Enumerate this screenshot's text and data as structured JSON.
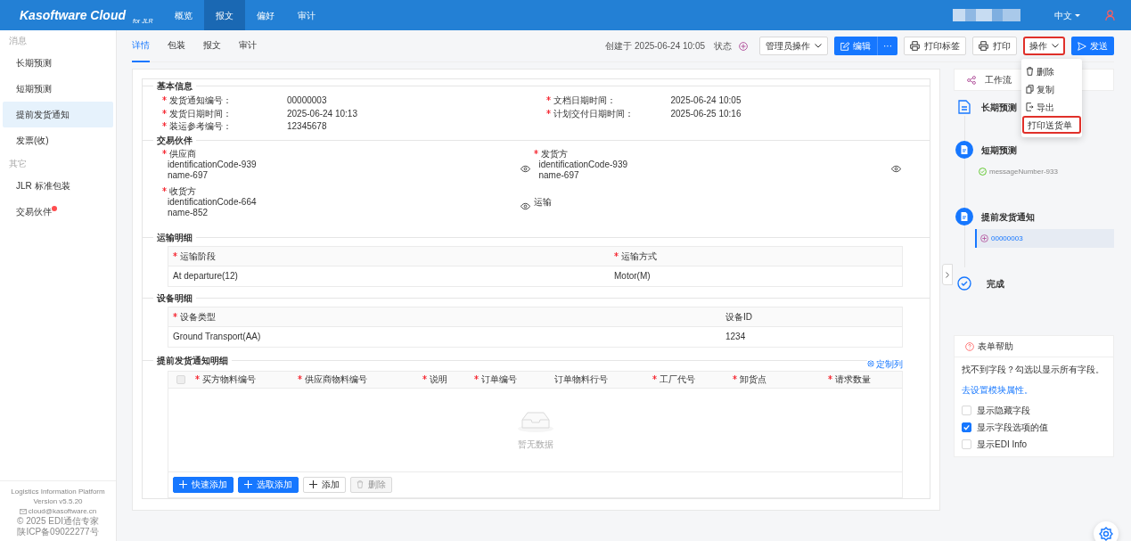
{
  "brand": {
    "name": "Kasoftware Cloud",
    "suffix": "for JLR"
  },
  "nav": [
    {
      "label": "概览",
      "selected": false
    },
    {
      "label": "报文",
      "selected": true
    },
    {
      "label": "偏好",
      "selected": false
    },
    {
      "label": "审计",
      "selected": false
    }
  ],
  "language": "中文",
  "sidebar": {
    "groups": [
      {
        "title": "消息",
        "items": [
          {
            "label": "长期预测",
            "selected": false
          },
          {
            "label": "短期预测",
            "selected": false
          },
          {
            "label": "提前发货通知",
            "selected": true
          },
          {
            "label": "发票(收)",
            "selected": false
          }
        ]
      },
      {
        "title": "其它",
        "items": [
          {
            "label": "JLR 标准包装",
            "selected": false
          },
          {
            "label": "交易伙伴",
            "selected": false,
            "badge": true
          }
        ]
      }
    ],
    "footer": [
      "Logistics Information Platform",
      "Version v5.5.20",
      "cloud@kasoftware.cn",
      "© 2025 EDI通信专家",
      "陕ICP备09022277号"
    ]
  },
  "tabs": [
    {
      "label": "详情",
      "selected": true
    },
    {
      "label": "包装",
      "selected": false
    },
    {
      "label": "报文",
      "selected": false
    },
    {
      "label": "审计",
      "selected": false
    }
  ],
  "toolbar": {
    "created": "创建于 2025-06-24 10:05",
    "status_label": "状态",
    "admin": "管理员操作",
    "edit": "编辑",
    "more": "···",
    "print_label": "打印标签",
    "print": "打印",
    "actions": {
      "label": "操作",
      "highlighted": true
    },
    "send": "发送"
  },
  "actions_menu": [
    {
      "label": "删除",
      "kind": "delete",
      "highlighted": false
    },
    {
      "label": "复制",
      "kind": "copy",
      "highlighted": false
    },
    {
      "label": "导出",
      "kind": "export",
      "highlighted": false
    },
    {
      "label": "打印送货单",
      "kind": "plain",
      "highlighted": true
    }
  ],
  "basic_info": {
    "title": "基本信息",
    "fields": [
      {
        "label": "发货通知编号：",
        "value": "00000003",
        "required": true
      },
      {
        "label": "文档日期时间：",
        "value": "2025-06-24 10:05",
        "required": true
      },
      {
        "label": "发货日期时间：",
        "value": "2025-06-24 10:13",
        "required": true
      },
      {
        "label": "计划交付日期时间：",
        "value": "2025-06-25 10:16",
        "required": true
      },
      {
        "label": "装运参考编号：",
        "value": "12345678",
        "required": true
      }
    ]
  },
  "partners": {
    "title": "交易伙伴",
    "items": [
      {
        "label": "供应商",
        "required": true,
        "lines": [
          "identificationCode-939",
          "name-697"
        ]
      },
      {
        "label": "发货方",
        "required": true,
        "lines": [
          "identificationCode-939",
          "name-697"
        ]
      },
      {
        "label": "收货方",
        "required": true,
        "lines": [
          "identificationCode-664",
          "name-852"
        ]
      },
      {
        "label": "运输",
        "required": false
      }
    ]
  },
  "transport": {
    "title": "运输明细",
    "columns": [
      {
        "label": "运输阶段",
        "required": true
      },
      {
        "label": "运输方式",
        "required": true
      }
    ],
    "rows": [
      [
        "At departure(12)",
        "Motor(M)"
      ]
    ]
  },
  "equipment": {
    "title": "设备明细",
    "columns": [
      {
        "label": "设备类型",
        "required": true
      },
      {
        "label": "设备ID",
        "required": false
      }
    ],
    "rows": [
      [
        "Ground Transport(AA)",
        "1234"
      ]
    ]
  },
  "lines": {
    "title": "提前发货通知明细",
    "customize": "定制列",
    "select_all": {
      "checked": false,
      "disabled": true
    },
    "columns": [
      {
        "label": "买方物料编号",
        "required": true
      },
      {
        "label": "供应商物料编号",
        "required": true
      },
      {
        "label": "说明",
        "required": true
      },
      {
        "label": "订单编号",
        "required": true
      },
      {
        "label": "订单物料行号",
        "required": false
      },
      {
        "label": "工厂代号",
        "required": true
      },
      {
        "label": "卸货点",
        "required": true
      },
      {
        "label": "请求数量",
        "required": true
      }
    ],
    "empty": "暂无数据",
    "buttons": [
      {
        "label": "快速添加",
        "kind": "primary",
        "disabled": false
      },
      {
        "label": "选取添加",
        "kind": "primary",
        "disabled": false
      },
      {
        "label": "添加",
        "kind": "default",
        "disabled": false
      },
      {
        "label": "删除",
        "kind": "default",
        "disabled": true
      }
    ]
  },
  "workflow": {
    "title": "工作流",
    "steps": [
      {
        "label": "长期预测",
        "kind": "file"
      },
      {
        "label": "短期预测",
        "kind": "filled",
        "items": [
          {
            "label": "messageNumber-933",
            "selected": false,
            "kind": "done"
          }
        ]
      },
      {
        "label": "提前发货通知",
        "kind": "filled",
        "items": [
          {
            "label": "00000003",
            "selected": true,
            "kind": "pending"
          }
        ]
      },
      {
        "label": "完成",
        "kind": "check"
      }
    ]
  },
  "help": {
    "title": "表单帮助",
    "text": "找不到字段？勾选以显示所有字段。",
    "link": "去设置模块属性。",
    "options": [
      {
        "label": "显示隐藏字段",
        "checked": false
      },
      {
        "label": "显示字段选项的值",
        "checked": true
      },
      {
        "label": "显示EDI Info",
        "checked": false
      }
    ]
  }
}
